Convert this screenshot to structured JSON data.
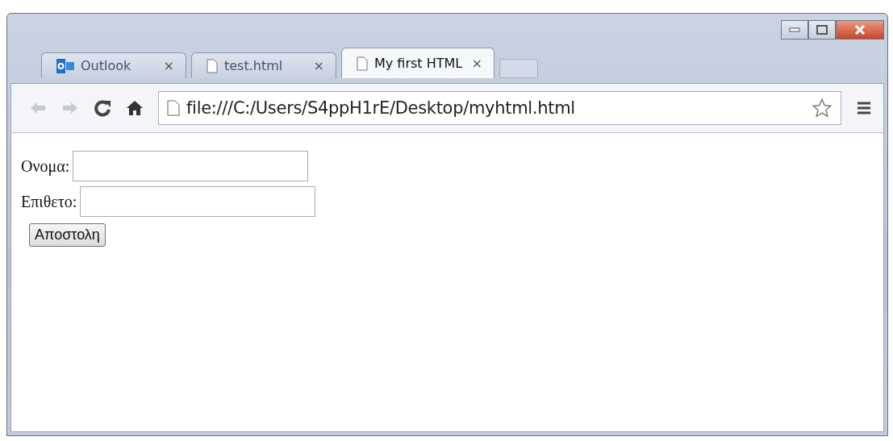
{
  "tabs": [
    {
      "kind": "outlook",
      "label": "Outlook",
      "close": "×",
      "selected": false
    },
    {
      "kind": "page",
      "label": "test.html",
      "close": "×",
      "selected": false
    },
    {
      "kind": "page",
      "label": "My first HTML",
      "close": "×",
      "selected": true
    }
  ],
  "address_bar": {
    "value": "file:///C:/Users/S4ppH1rE/Desktop/myhtml.html"
  },
  "form": {
    "fields": [
      {
        "label": "Ονομα:"
      },
      {
        "label": "Επιθετο:"
      }
    ],
    "submit": "Αποστολη"
  }
}
